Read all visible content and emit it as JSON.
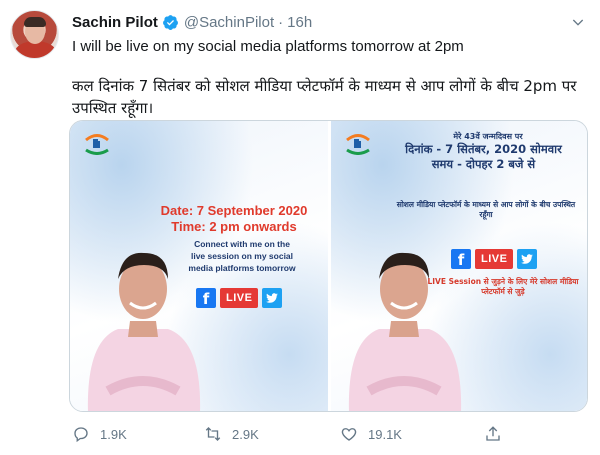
{
  "tweet": {
    "author_name": "Sachin Pilot",
    "handle": "@SachinPilot",
    "separator": "·",
    "time": "16h",
    "text_en": "I will be live on my social media platforms tomorrow at 2pm",
    "text_hi": "कल दिनांक 7 सितंबर को सोशल मीडिया प्लेटफॉर्म के माध्यम से आप लोगों के बीच 2pm पर उपस्थित रहूँगा।"
  },
  "media": {
    "left_image": {
      "date_text": "Date: 7 September 2020",
      "time_text": "Time: 2 pm onwards",
      "connect_text": "Connect with me on the live session on my social media platforms tomorrow",
      "live_label": "LIVE",
      "fb_glyph": "f"
    },
    "right_image": {
      "birthday_line": "मेरे 43वें जन्मदिवस पर",
      "date_line": "दिनांक - 7 सितंबर, 2020 सोमवार",
      "time_line": "समय - दोपहर 2 बजे से",
      "platform_line": "सोशल मीडिया प्लेटफॉर्म के माध्यम से आप लोगों के बीच उपस्थित रहूँगा",
      "live_label": "LIVE",
      "fb_glyph": "f",
      "join_line": "LIVE Session से जुड़ने के लिए मेरे सोशल मीडिया प्लेटफॉर्म से जुड़े"
    }
  },
  "actions": {
    "replies": "1.9K",
    "retweets": "2.9K",
    "likes": "19.1K"
  },
  "icons": {
    "verified": "verified-badge-icon",
    "caret": "chevron-down-icon",
    "reply": "reply-icon",
    "retweet": "retweet-icon",
    "like": "heart-icon",
    "share": "share-icon"
  },
  "colors": {
    "verified_blue": "#1da1f2",
    "text_primary": "#14171a",
    "text_secondary": "#657786",
    "poster_red": "#e03a2c",
    "poster_navy": "#1f3a6e",
    "facebook_blue": "#1877f2",
    "live_red": "#e53935"
  }
}
